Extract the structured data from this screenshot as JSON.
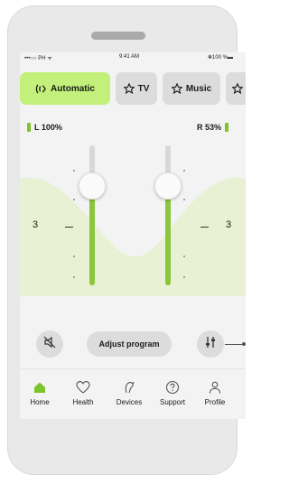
{
  "status_bar": {
    "carrier": "•••○○ PH ᯤ",
    "time": "9:41 AM",
    "battery": "✻100 %▬"
  },
  "programs": [
    {
      "label": "Automatic",
      "icon": "automatic-program-icon",
      "active": true
    },
    {
      "label": "TV",
      "icon": "star-icon",
      "active": false
    },
    {
      "label": "Music",
      "icon": "star-icon",
      "active": false
    },
    {
      "label": "",
      "icon": "star-icon",
      "active": false
    }
  ],
  "battery": {
    "left": "L 100%",
    "right": "R 53%"
  },
  "volume": {
    "left": "3",
    "right": "3",
    "left_level": 0.72,
    "right_level": 0.72
  },
  "controls": {
    "adjust_label": "Adjust program"
  },
  "tabs": [
    {
      "label": "Home",
      "icon": "home-icon",
      "active": true
    },
    {
      "label": "Health",
      "icon": "heart-icon",
      "active": false
    },
    {
      "label": "Devices",
      "icon": "hearing-aid-icon",
      "active": false
    },
    {
      "label": "Support",
      "icon": "help-icon",
      "active": false
    },
    {
      "label": "Profile",
      "icon": "profile-icon",
      "active": false
    }
  ],
  "colors": {
    "accent": "#c3f07a",
    "slider_fill": "#8cc63f",
    "active_icon": "#7dc42c"
  }
}
